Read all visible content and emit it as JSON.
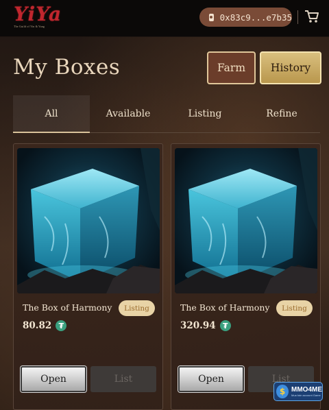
{
  "header": {
    "logo_text": "YiYa",
    "logo_subtitle": "The Guild of Yin & Yang",
    "wallet_address": "0x83c9...e7b35",
    "wallet_icon": "wallet-icon",
    "cart_icon": "cart-icon"
  },
  "page": {
    "title": "My Boxes",
    "farm_label": "Farm",
    "history_label": "History"
  },
  "tabs": [
    {
      "label": "All",
      "active": true
    },
    {
      "label": "Available",
      "active": false
    },
    {
      "label": "Listing",
      "active": false
    },
    {
      "label": "Refine",
      "active": false
    }
  ],
  "cards": [
    {
      "name": "The Box of Harmony",
      "status": "Listing",
      "price": "80.82",
      "currency_icon": "tether-icon",
      "open_label": "Open",
      "list_label": "List"
    },
    {
      "name": "The Box of Harmony",
      "status": "Listing",
      "price": "320.94",
      "currency_icon": "tether-icon",
      "open_label": "Open",
      "list_label": "List"
    }
  ],
  "watermark": {
    "title": "MMO4ME",
    "subtitle": "Mua bán account Game"
  },
  "colors": {
    "accent_gold": "#d9bf7e",
    "farm_brown": "#6b3d2a",
    "wallet_bg": "#7a4b37",
    "tether_green": "#3aa07f",
    "logo_red": "#c0262e"
  }
}
